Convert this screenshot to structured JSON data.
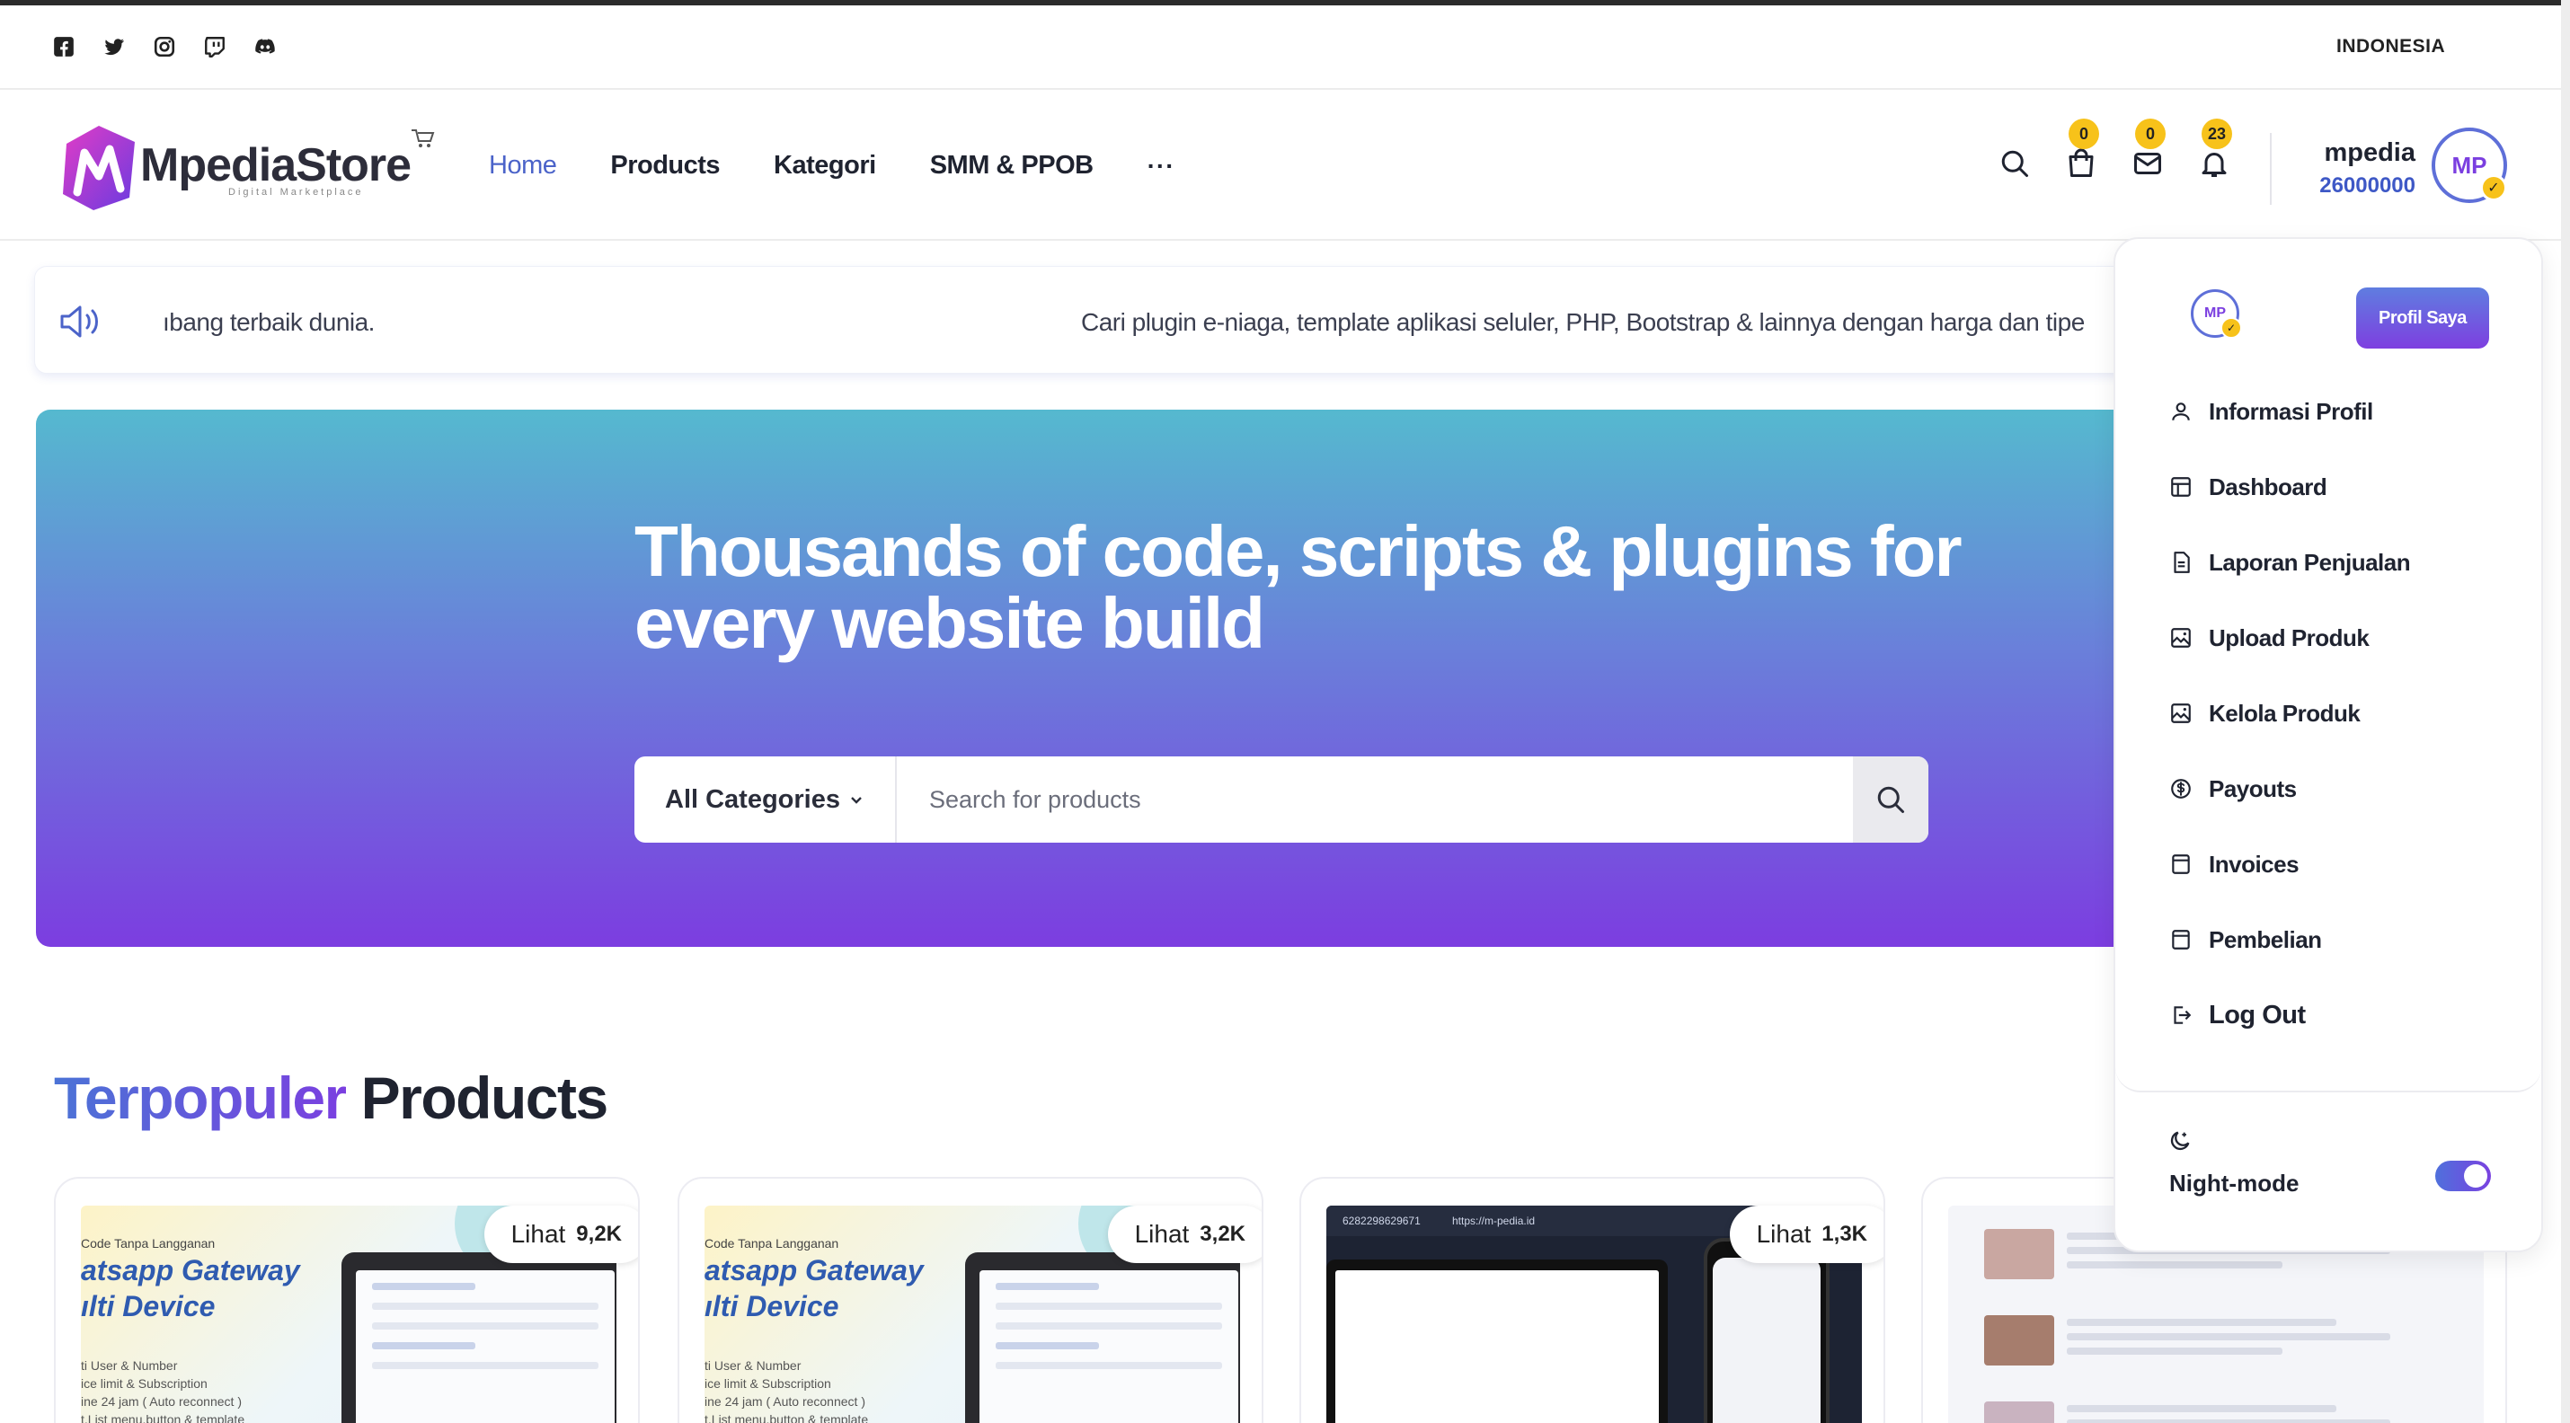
{
  "social": {
    "icons": [
      "facebook-icon",
      "twitter-icon",
      "instagram-icon",
      "twitch-icon",
      "discord-icon"
    ],
    "language": "INDONESIA"
  },
  "header": {
    "logo_text": "MpediaStore",
    "logo_sub": "Digital Marketplace",
    "nav": [
      "Home",
      "Products",
      "Kategori",
      "SMM & PPOB"
    ],
    "nav_more": "···",
    "badges": {
      "cart": "0",
      "mail": "0",
      "notifications": "23"
    },
    "user": {
      "name": "mpedia",
      "balance": "26000000",
      "avatar_text": "MP"
    }
  },
  "announcement": {
    "text_a": "ıbang terbaik dunia.",
    "text_b": "Cari plugin e-niaga, template aplikasi seluler, PHP, Bootstrap & lainnya dengan harga dan tipe"
  },
  "hero": {
    "title": "Thousands of code, scripts & plugins for every website build",
    "category_select": "All Categories",
    "search_placeholder": "Search for products"
  },
  "section": {
    "title_highlight": "Terpopuler",
    "title_rest": " Products"
  },
  "products": [
    {
      "views_label": "Lihat",
      "views": "9,2K",
      "tag": "Code Tanpa Langganan",
      "title_line1": "atsapp Gateway",
      "title_line2": "ılti Device",
      "lines": [
        "ti User & Number",
        "ice limit & Subscription",
        "ine 24 jam ( Auto reconnect )",
        "t,List menu,button & template"
      ]
    },
    {
      "views_label": "Lihat",
      "views": "3,2K",
      "tag": "Code Tanpa Langganan",
      "title_line1": "atsapp Gateway",
      "title_line2": "ılti Device",
      "lines": [
        "ti User & Number",
        "ice limit & Subscription",
        "ine 24 jam ( Auto reconnect )",
        "t,List menu,button & template"
      ]
    },
    {
      "views_label": "Lihat",
      "views": "1,3K",
      "top_text_1": "6282298629671",
      "top_text_2": "https://m-pedia.id"
    },
    {
      "views_label": "Lihat",
      "views": ""
    }
  ],
  "dropdown": {
    "avatar_text": "MP",
    "profile_button": "Profil Saya",
    "items": [
      {
        "label": "Informasi Profil",
        "icon": "user-icon"
      },
      {
        "label": "Dashboard",
        "icon": "dashboard-icon"
      },
      {
        "label": "Laporan Penjualan",
        "icon": "report-icon"
      },
      {
        "label": "Upload Produk",
        "icon": "image-upload-icon"
      },
      {
        "label": "Kelola Produk",
        "icon": "image-manage-icon"
      },
      {
        "label": "Payouts",
        "icon": "dollar-circle-icon"
      },
      {
        "label": "Invoices",
        "icon": "invoice-icon"
      },
      {
        "label": "Pembelian",
        "icon": "purchase-icon"
      },
      {
        "label": "Log Out",
        "icon": "logout-icon"
      }
    ],
    "night_mode_label": "Night-mode",
    "night_mode_on": true
  },
  "colors": {
    "accent": "#4b63c9",
    "badge": "#f7c21a",
    "hero_top": "#55b9cf",
    "hero_bottom": "#7c3de0"
  }
}
